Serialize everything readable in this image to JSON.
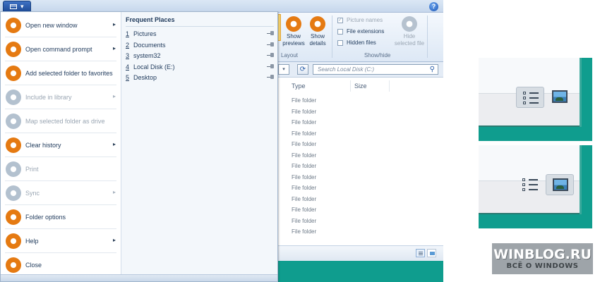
{
  "colors": {
    "accent_orange": "#e57a12",
    "teal_desktop": "#0f9d8e",
    "menu_text": "#1e395b",
    "disabled_text": "#9aa6b3"
  },
  "explorer": {
    "ribbon": {
      "show_previews": "Show\npreviews",
      "show_details": "Show\ndetails",
      "layout_group": "Layout",
      "picture_names": "Picture names",
      "file_extensions": "File extensions",
      "hidden_files": "Hidden files",
      "hide_selected": "Hide\nselected file",
      "showhide_group": "Show/hide"
    },
    "search_placeholder": "Search Local Disk (C:)",
    "columns": {
      "type": "Type",
      "size": "Size"
    },
    "rows": [
      "File folder",
      "File folder",
      "File folder",
      "File folder",
      "File folder",
      "File folder",
      "File folder",
      "File folder",
      "File folder",
      "File folder",
      "File folder",
      "File folder",
      "File folder"
    ]
  },
  "app_menu": {
    "items": [
      {
        "label": "Open new window",
        "arrow": "▸",
        "icon": "orange-disc-icon",
        "enabled": true
      },
      {
        "label": "Open command prompt",
        "arrow": "▸",
        "icon": "orange-disc-icon",
        "enabled": true
      },
      {
        "label": "Add selected folder to favorites",
        "arrow": "",
        "icon": "orange-disc-icon",
        "enabled": true
      },
      {
        "label": "Include in library",
        "arrow": "▸",
        "icon": "gray-disc-icon",
        "enabled": false
      },
      {
        "label": "Map selected folder as drive",
        "arrow": "",
        "icon": "gray-disc-icon",
        "enabled": false
      },
      {
        "label": "Clear history",
        "arrow": "▸",
        "icon": "orange-disc-icon",
        "enabled": true
      },
      {
        "label": "Print",
        "arrow": "",
        "icon": "gray-disc-icon",
        "enabled": false
      },
      {
        "label": "Sync",
        "arrow": "▸",
        "icon": "gray-disc-icon",
        "enabled": false
      },
      {
        "label": "Folder options",
        "arrow": "",
        "icon": "orange-disc-icon",
        "enabled": true
      },
      {
        "label": "Help",
        "arrow": "▸",
        "icon": "orange-disc-icon",
        "enabled": true
      },
      {
        "label": "Close",
        "arrow": "",
        "icon": "orange-disc-icon",
        "enabled": true
      }
    ],
    "frequent_title": "Frequent Places",
    "places": [
      {
        "num": "1",
        "label": "Pictures"
      },
      {
        "num": "2",
        "label": "Documents"
      },
      {
        "num": "3",
        "label": "system32"
      },
      {
        "num": "4",
        "label": "Local Disk (E:)"
      },
      {
        "num": "5",
        "label": "Desktop"
      }
    ]
  },
  "zoom_panels": [
    {
      "selected_view": "details"
    },
    {
      "selected_view": "large-icons"
    }
  ],
  "watermark": {
    "title": "WINBLOG.RU",
    "subtitle": "ВСЁ О WINDOWS"
  }
}
